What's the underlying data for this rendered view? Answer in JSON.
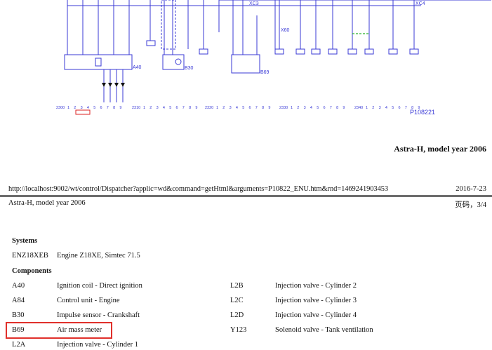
{
  "diagram": {
    "labels": {
      "xc3": "XC3",
      "xc4": "XC4",
      "a40": "A40",
      "b30": "B30",
      "b69": "B69",
      "x60": "X60",
      "figure_id": "P108221"
    },
    "pin_strip": {
      "group_labels": [
        "2300",
        "2310",
        "2320",
        "2330",
        "2340"
      ],
      "digits": [
        "1",
        "2",
        "3",
        "4",
        "5",
        "6",
        "7",
        "8",
        "9"
      ]
    },
    "colors": {
      "wire": "#3a3ad6",
      "ground_link": "#2bb52b"
    }
  },
  "print_header": {
    "title": "Astra-H, model year 2006"
  },
  "footer": {
    "url": "http://localhost:9002/wt/control/Dispatcher?applic=wd&command=getHtml&arguments=P10822_ENU.htm&rnd=1469241903453",
    "date": "2016-7-23"
  },
  "page_header": {
    "title": "Astra-H, model year 2006",
    "page": "页码，3/4"
  },
  "systems": {
    "heading": "Systems",
    "items": [
      {
        "code": "ENZ18XEB",
        "name": "Engine Z18XE, Simtec 71.5"
      }
    ]
  },
  "components": {
    "heading": "Components",
    "left": [
      {
        "code": "A40",
        "name": "Ignition coil - Direct ignition"
      },
      {
        "code": "A84",
        "name": "Control unit - Engine"
      },
      {
        "code": "B30",
        "name": "Impulse sensor - Crankshaft"
      },
      {
        "code": "B69",
        "name": "Air mass meter"
      },
      {
        "code": "L2A",
        "name": "Injection valve - Cylinder 1"
      }
    ],
    "right": [
      {
        "code": "L2B",
        "name": "Injection valve - Cylinder 2"
      },
      {
        "code": "L2C",
        "name": "Injection valve - Cylinder 3"
      },
      {
        "code": "L2D",
        "name": "Injection valve - Cylinder 4"
      },
      {
        "code": "Y123",
        "name": "Solenoid valve - Tank ventilation"
      }
    ],
    "highlighted": "B69"
  }
}
